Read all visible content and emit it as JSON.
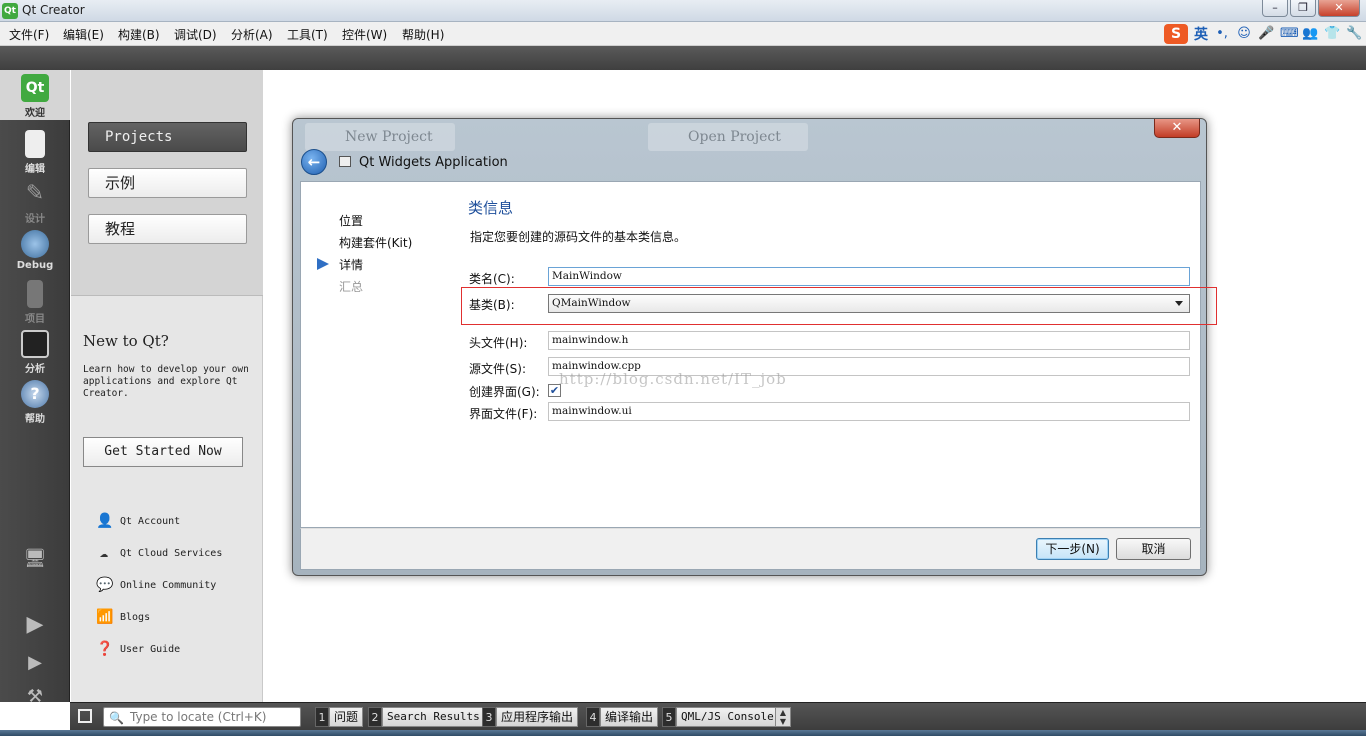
{
  "window": {
    "title": "Qt Creator"
  },
  "menubar": {
    "items": [
      "文件(F)",
      "编辑(E)",
      "构建(B)",
      "调试(D)",
      "分析(A)",
      "工具(T)",
      "控件(W)",
      "帮助(H)"
    ]
  },
  "tray": {
    "ime_label": "英"
  },
  "modes": [
    {
      "label": "欢迎",
      "icon": "qt-logo-icon"
    },
    {
      "label": "编辑",
      "icon": "edit-icon"
    },
    {
      "label": "设计",
      "icon": "design-icon"
    },
    {
      "label": "Debug",
      "icon": "debug-icon"
    },
    {
      "label": "项目",
      "icon": "projects-icon"
    },
    {
      "label": "分析",
      "icon": "analyze-icon"
    },
    {
      "label": "帮助",
      "icon": "help-icon"
    }
  ],
  "welcome": {
    "buttons": [
      "Projects",
      "示例",
      "教程"
    ],
    "new_to_qt": "New to Qt?",
    "learn_text": "Learn how to develop your own applications and explore Qt Creator.",
    "get_started": "Get Started Now",
    "links": [
      "Qt Account",
      "Qt Cloud Services",
      "Online Community",
      "Blogs",
      "User Guide"
    ]
  },
  "dialog": {
    "ghost_left": "New Project",
    "ghost_right": "Open Project",
    "close_glyph": "✕",
    "title": "Qt Widgets Application",
    "steps": [
      "位置",
      "构建套件(Kit)",
      "详情",
      "汇总"
    ],
    "current_step_index": 2,
    "section_title": "类信息",
    "section_desc": "指定您要创建的源码文件的基本类信息。",
    "fields": {
      "class_name": {
        "label": "类名(C):",
        "value": "MainWindow"
      },
      "base_class": {
        "label": "基类(B):",
        "value": "QMainWindow"
      },
      "header_file": {
        "label": "头文件(H):",
        "value": "mainwindow.h"
      },
      "source_file": {
        "label": "源文件(S):",
        "value": "mainwindow.cpp"
      },
      "generate_form": {
        "label": "创建界面(G):",
        "checked": true
      },
      "form_file": {
        "label": "界面文件(F):",
        "value": "mainwindow.ui"
      }
    },
    "watermark": "http://blog.csdn.net/IT_job",
    "next_button": "下一步(N)",
    "cancel_button": "取消"
  },
  "statusbar": {
    "locate_placeholder": "Type to locate (Ctrl+K)",
    "tabs": [
      {
        "num": "1",
        "label": "问题"
      },
      {
        "num": "2",
        "label": "Search Results"
      },
      {
        "num": "3",
        "label": "应用程序输出"
      },
      {
        "num": "4",
        "label": "编译输出"
      },
      {
        "num": "5",
        "label": "QML/JS Console"
      }
    ]
  }
}
